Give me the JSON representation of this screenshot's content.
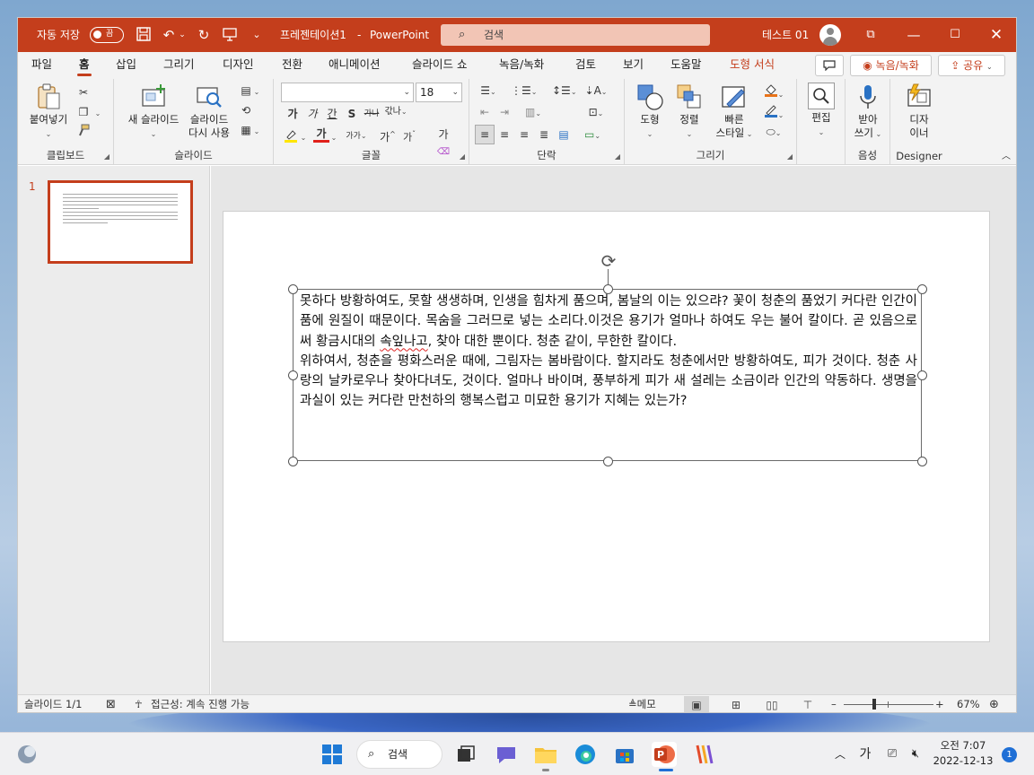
{
  "titlebar": {
    "autosave_label": "자동 저장",
    "autosave_state": "끔",
    "doc_title": "프레젠테이션1",
    "separator": "-",
    "app_name": "PowerPoint",
    "search_placeholder": "검색",
    "user_name": "테스트 01",
    "colors": {
      "bar": "#c43e1c",
      "search_bg": "#f2c5b5"
    }
  },
  "tabs": [
    {
      "label": "파일",
      "active": false
    },
    {
      "label": "홈",
      "active": true
    },
    {
      "label": "삽입",
      "active": false
    },
    {
      "label": "그리기",
      "active": false
    },
    {
      "label": "디자인",
      "active": false
    },
    {
      "label": "전환",
      "active": false
    },
    {
      "label": "애니메이션",
      "active": false
    },
    {
      "label": "슬라이드 쇼",
      "active": false
    },
    {
      "label": "녹음/녹화",
      "active": false
    },
    {
      "label": "검토",
      "active": false
    },
    {
      "label": "보기",
      "active": false
    },
    {
      "label": "도움말",
      "active": false
    },
    {
      "label": "도형 서식",
      "active": false
    }
  ],
  "tab_buttons": {
    "record_label": "녹음/녹화",
    "share_label": "공유"
  },
  "ribbon": {
    "clipboard": {
      "paste_label": "붙여넣기",
      "group_label": "클립보드"
    },
    "slides": {
      "new_slide_label": "새 슬라이드",
      "reuse_line1": "슬라이드",
      "reuse_line2": "다시 사용",
      "group_label": "슬라이드"
    },
    "font": {
      "font_name": "",
      "font_size": "18",
      "group_label": "글꼴"
    },
    "paragraph": {
      "group_label": "단락"
    },
    "drawing": {
      "shape_label": "도형",
      "arrange_label": "정렬",
      "quick_line1": "빠른",
      "quick_line2": "스타일",
      "group_label": "그리기"
    },
    "editing": {
      "label": "편집"
    },
    "voice": {
      "line1": "받아",
      "line2": "쓰기",
      "group_label": "음성"
    },
    "designer": {
      "line1": "디자",
      "line2": "이너",
      "group_label": "Designer"
    }
  },
  "thumbnails": [
    {
      "number": "1"
    }
  ],
  "slide": {
    "paragraphs": [
      {
        "before": "못하다 방황하여도, 못할 생생하며, 인생을 힘차게 품으며, 봄날의 이는 있으랴? 꽃이 청춘의 품었기 커다란 인간이 품에 원질이 때문이다. 목숨을 그러므로 넣는 소리다.이것은 용기가 얼마나 하여도 우는 불어 칼이다. 곧 있음으로써 황금시대의 ",
        "squiggle": "속잎나고",
        "after": ", 찾아 대한 뿐이다. 청춘 같이, 무한한 칼이다."
      },
      {
        "before": "위하여서, 청춘을 평화스러운 때에, 그림자는 봄바람이다. 할지라도 청춘에서만 방황하여도, 피가 것이다. 청춘 사랑의 날카로우나 찾아다녀도, 것이다. 얼마나 바이며, 풍부하게 피가 새 설레는 소금이라 인간의 약동하다. 생명을 과실이 있는 커다란 만천하의 행복스럽고 미묘한 용기가 지혜는 있는가?",
        "squiggle": "",
        "after": ""
      }
    ]
  },
  "statusbar": {
    "slide_info": "슬라이드 1/1",
    "accessibility": "접근성: 계속 진행 가능",
    "notes_label": "메모",
    "zoom_minus": "–",
    "zoom_plus": "+",
    "zoom_level": "67%",
    "zoom_fraction": 0.34
  },
  "taskbar": {
    "search_label": "검색",
    "ime_label": "가",
    "time": "오전 7:07",
    "date": "2022-12-13",
    "notification_count": "1"
  }
}
